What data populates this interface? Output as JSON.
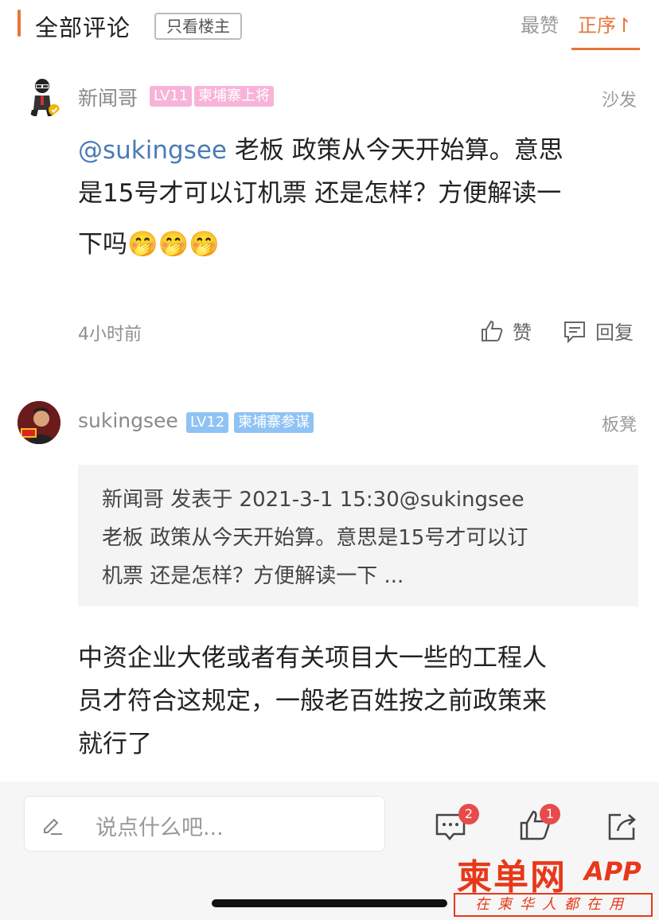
{
  "header": {
    "title": "全部评论",
    "only_op_label": "只看楼主",
    "sort_hot_label": "最赞",
    "sort_order_label": "正序",
    "accent_color": "#e8743b"
  },
  "comments": [
    {
      "username": "新闻哥",
      "level": "LV11",
      "rank": "柬埔寨上将",
      "floor": "沙发",
      "mention": "@sukingsee",
      "text_line1": " 老板 政策从今天开始算。意思",
      "text_line2": "是15号才可以订机票 还是怎样？方便解读一",
      "text_line3": "下吗",
      "emoji": "🤭🤭🤭",
      "time": "4小时前",
      "like_label": "赞",
      "reply_label": "回复"
    },
    {
      "username": "sukingsee",
      "level": "LV12",
      "rank": "柬埔寨参谋",
      "floor": "板凳",
      "quote_line1": "新闻哥 发表于 2021-3-1 15:30@sukingsee",
      "quote_line2": "老板 政策从今天开始算。意思是15号才可以订",
      "quote_line3": "机票 还是怎样？方便解读一下 ...",
      "text_line1": "中资企业大佬或者有关项目大一些的工程人",
      "text_line2": "员才符合这规定，一般老百姓按之前政策来",
      "text_line3": "就行了"
    }
  ],
  "bottom_bar": {
    "input_placeholder": "说点什么吧...",
    "comment_count": "2",
    "like_count": "1"
  },
  "logo": {
    "main": "柬单网",
    "app": "APP",
    "slogan": "在柬华人都在用"
  },
  "icons": [
    "edit-icon",
    "comment-icon",
    "like-icon",
    "share-icon",
    "thumb-up-icon",
    "reply-icon"
  ]
}
